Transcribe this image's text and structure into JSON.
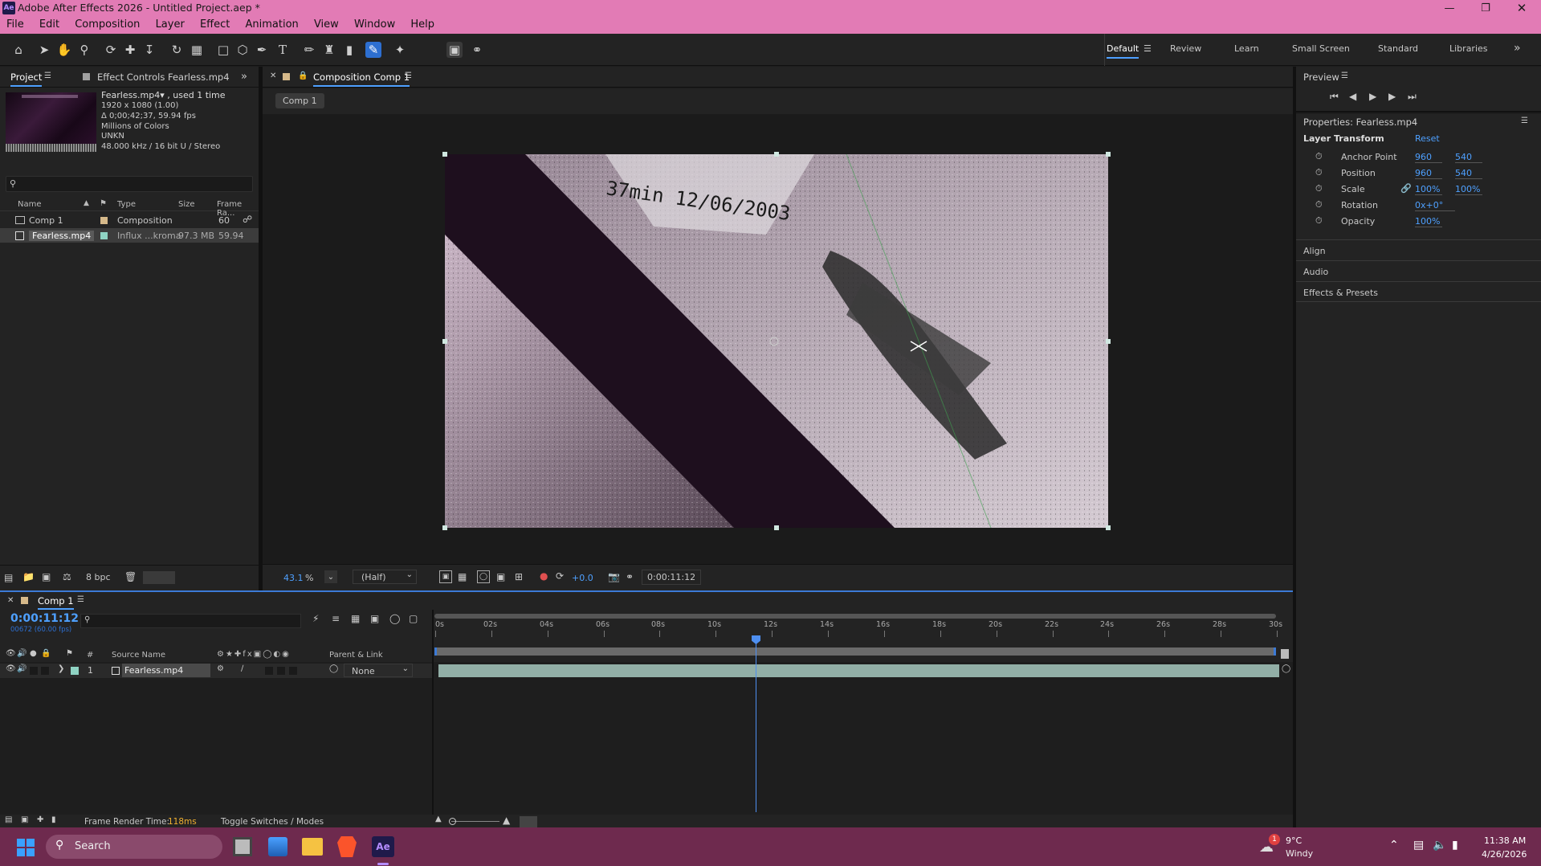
{
  "title_bar": {
    "app_icon": "Ae",
    "title": "Adobe After Effects 2026 - Untitled Project.aep *"
  },
  "menu": [
    "File",
    "Edit",
    "Composition",
    "Layer",
    "Effect",
    "Animation",
    "View",
    "Window",
    "Help"
  ],
  "workspaces": [
    "Default",
    "Review",
    "Learn",
    "Small Screen",
    "Standard",
    "Libraries"
  ],
  "project_panel": {
    "tab_project": "Project",
    "tab_effect_controls": "Effect Controls Fearless.mp4",
    "file_name": "Fearless.mp4▾ , used 1 time",
    "info_lines": [
      "1920 x 1080 (1.00)",
      "Δ 0;00;42;37, 59.94 fps",
      "Millions of Colors",
      "UNKN",
      "48.000 kHz / 16 bit U / Stereo"
    ],
    "search_placeholder": "",
    "columns": [
      "Name",
      "Type",
      "Size",
      "Frame Ra..."
    ],
    "rows": [
      {
        "name": "Comp 1",
        "type": "Composition",
        "size": "",
        "fps": "60"
      },
      {
        "name": "Fearless.mp4",
        "type": "Influx ...kroma",
        "size": "97.3 MB",
        "fps": "59.94"
      }
    ],
    "bpc": "8 bpc"
  },
  "comp_panel": {
    "tab": "Composition Comp 1",
    "breadcrumb": "Comp 1",
    "zoom": "43.1",
    "zoom_unit": "%",
    "resolution": "(Half)",
    "exposure": "+0.0",
    "timecode": "0:00:11:12",
    "overlay_text": "37min    12/06/2003"
  },
  "preview": {
    "title": "Preview"
  },
  "properties": {
    "title": "Properties: Fearless.mp4",
    "section": "Layer Transform",
    "reset": "Reset",
    "props": [
      {
        "label": "Anchor Point",
        "v1": "960",
        "v2": "540"
      },
      {
        "label": "Position",
        "v1": "960",
        "v2": "540"
      },
      {
        "label": "Scale",
        "v1": "100%",
        "v2": "100%"
      },
      {
        "label": "Rotation",
        "v1": "0x+0°",
        "v2": ""
      },
      {
        "label": "Opacity",
        "v1": "100%",
        "v2": ""
      }
    ],
    "sections": [
      "Align",
      "Audio",
      "Effects & Presets"
    ]
  },
  "timeline": {
    "tab": "Comp 1",
    "timecode": "0:00:11:12",
    "frame_info": "00672 (60.00 fps)",
    "columns": {
      "source_name": "Source Name",
      "parent": "Parent & Link",
      "num": "#"
    },
    "layer": {
      "index": "1",
      "name": "Fearless.mp4",
      "parent": "None"
    },
    "ruler": [
      "0s",
      "02s",
      "04s",
      "06s",
      "08s",
      "10s",
      "12s",
      "14s",
      "16s",
      "18s",
      "20s",
      "22s",
      "24s",
      "26s",
      "28s",
      "30s"
    ],
    "playhead_fraction": 0.381,
    "render_label": "Frame Render Time:",
    "render_value": "118ms",
    "toggle_label": "Toggle Switches / Modes"
  },
  "taskbar": {
    "search": "Search",
    "weather_temp": "9°C",
    "weather_desc": "Windy",
    "time": "11:38 AM",
    "date": "4/26/2026",
    "notification_badge": "1"
  },
  "colors": {
    "accent": "#4ea0ff",
    "titlebar": "#e27bb5",
    "taskbar": "#6e2a4e",
    "label_teal": "#8fd3c3"
  }
}
